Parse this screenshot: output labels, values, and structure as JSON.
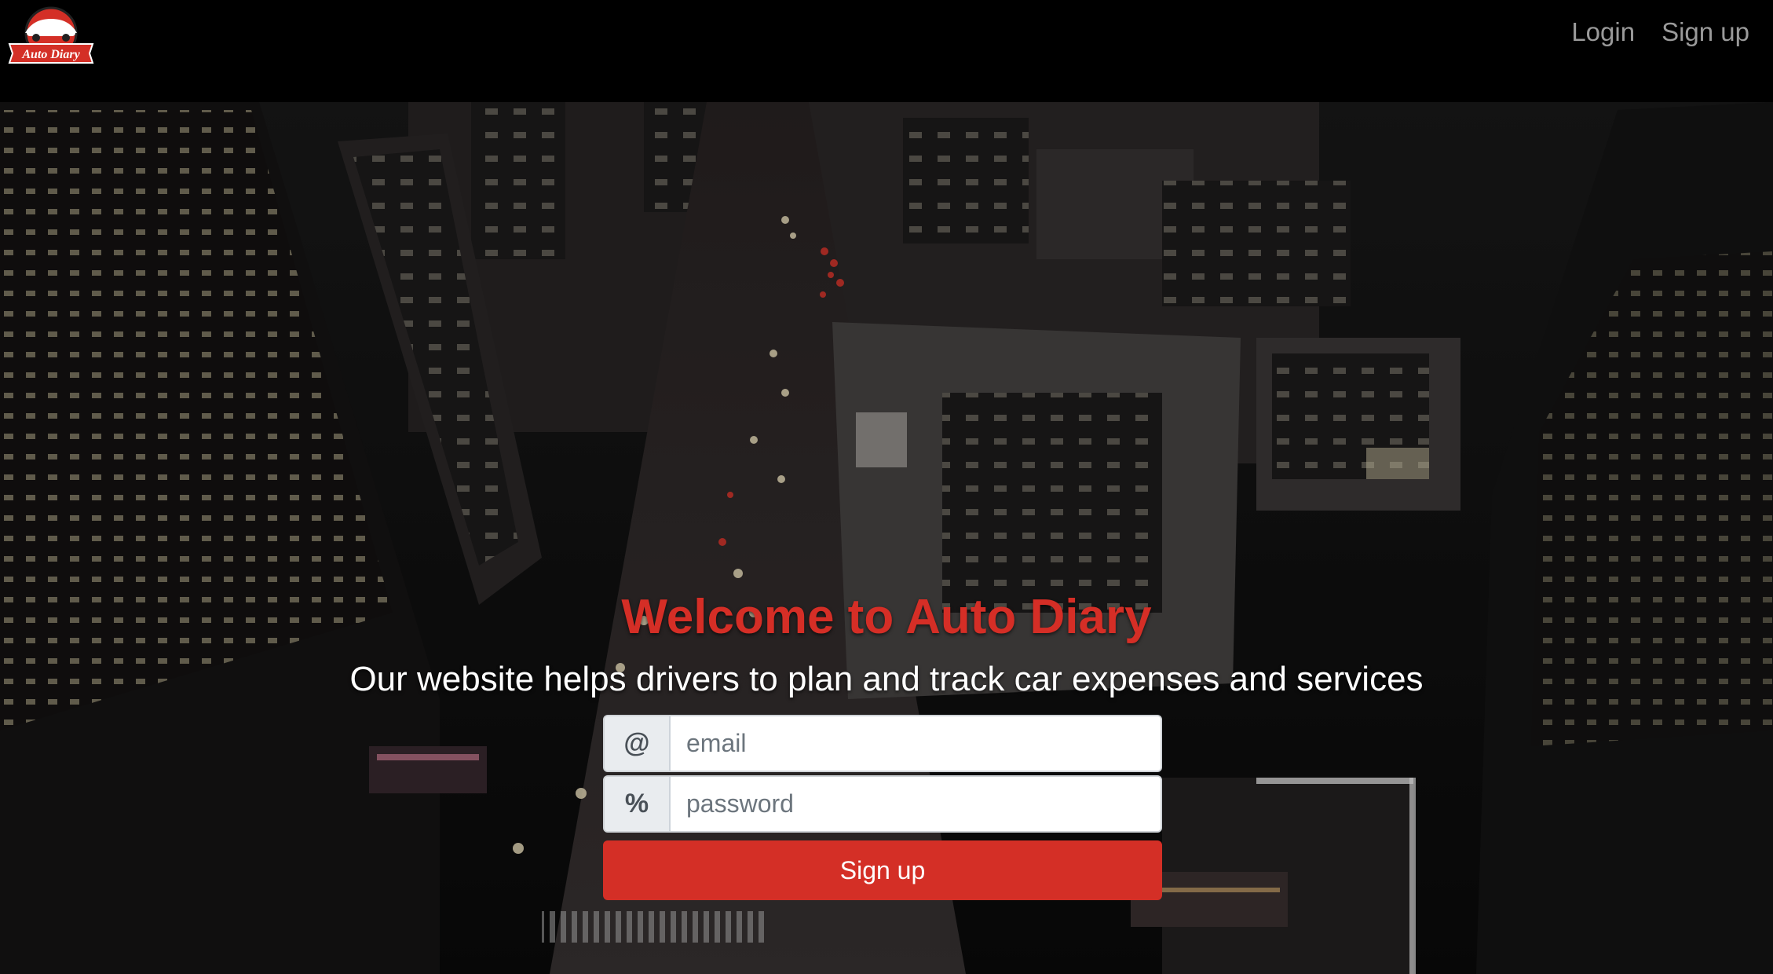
{
  "navbar": {
    "logo_text": "Auto Diary",
    "links": [
      {
        "label": "Login"
      },
      {
        "label": "Sign up"
      }
    ]
  },
  "hero": {
    "title": "Welcome to Auto Diary",
    "subtitle": "Our website helps drivers to plan and track car expenses and services"
  },
  "form": {
    "email": {
      "addon": "@",
      "placeholder": "email",
      "value": ""
    },
    "password": {
      "addon": "%",
      "placeholder": "password",
      "value": ""
    },
    "submit_label": "Sign up"
  },
  "colors": {
    "accent": "#d42f26",
    "nav_text": "#9a9a9a",
    "background": "#000000"
  },
  "icons": {
    "logo": "car-icon",
    "email_addon": "at-sign-icon",
    "password_addon": "percent-icon"
  }
}
